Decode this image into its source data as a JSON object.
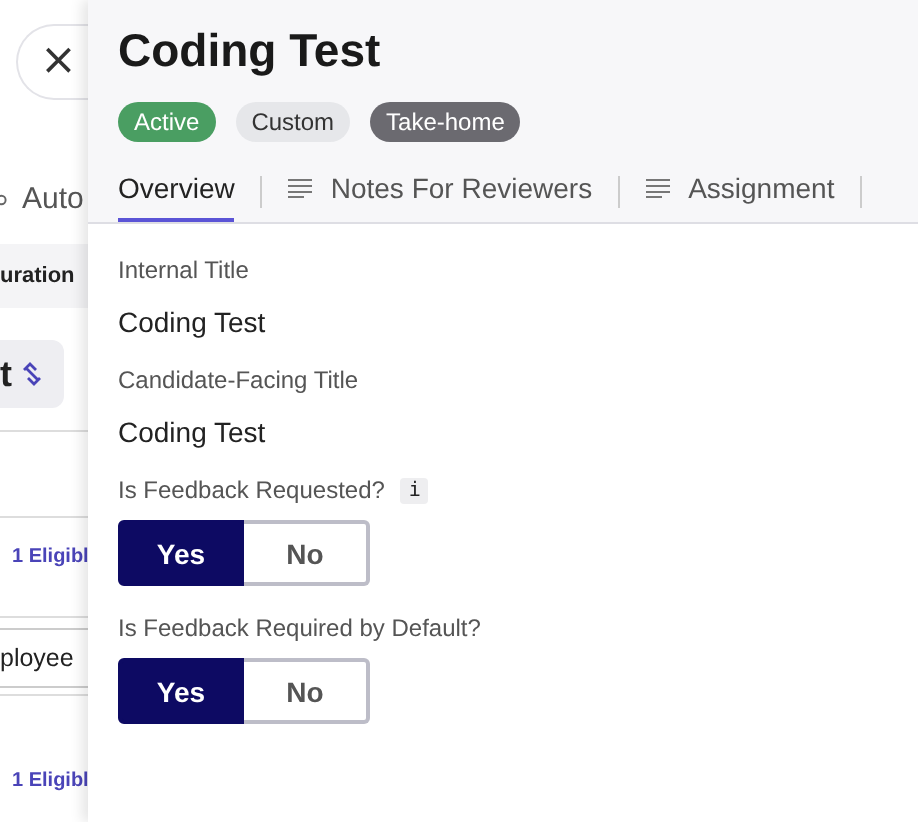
{
  "background": {
    "close_label": "×",
    "automation_text": "Auto",
    "column_header": "uration",
    "chip_text": "t",
    "eligible_links": [
      "1 Eligibl",
      "1 Eligibl"
    ],
    "field_value": "ployee"
  },
  "panel": {
    "title": "Coding Test",
    "badges": [
      {
        "label": "Active",
        "kind": "status"
      },
      {
        "label": "Custom",
        "kind": "light"
      },
      {
        "label": "Take-home",
        "kind": "dark"
      }
    ],
    "tabs": [
      {
        "label": "Overview",
        "selected": true,
        "icon": false
      },
      {
        "label": "Notes For Reviewers",
        "selected": false,
        "icon": true
      },
      {
        "label": "Assignment",
        "selected": false,
        "icon": true
      }
    ],
    "fields": [
      {
        "kind": "text",
        "label": "Internal Title",
        "value": "Coding Test"
      },
      {
        "kind": "text",
        "label": "Candidate-Facing Title",
        "value": "Coding Test"
      },
      {
        "kind": "toggle",
        "label": "Is Feedback Requested?",
        "info": "i",
        "options": [
          {
            "label": "Yes",
            "selected": true
          },
          {
            "label": "No",
            "selected": false
          }
        ]
      },
      {
        "kind": "toggle",
        "label": "Is Feedback Required by Default?",
        "options": [
          {
            "label": "Yes",
            "selected": true
          },
          {
            "label": "No",
            "selected": false
          }
        ]
      }
    ]
  }
}
